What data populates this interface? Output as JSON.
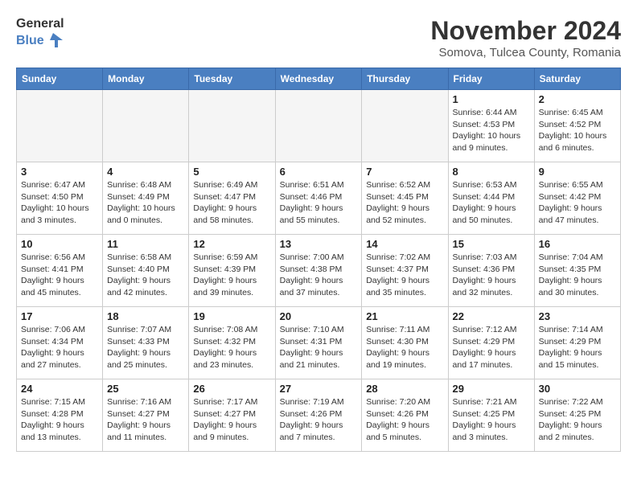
{
  "header": {
    "logo_line1": "General",
    "logo_line2": "Blue",
    "month_title": "November 2024",
    "subtitle": "Somova, Tulcea County, Romania"
  },
  "days_of_week": [
    "Sunday",
    "Monday",
    "Tuesday",
    "Wednesday",
    "Thursday",
    "Friday",
    "Saturday"
  ],
  "weeks": [
    [
      {
        "day": "",
        "info": ""
      },
      {
        "day": "",
        "info": ""
      },
      {
        "day": "",
        "info": ""
      },
      {
        "day": "",
        "info": ""
      },
      {
        "day": "",
        "info": ""
      },
      {
        "day": "1",
        "info": "Sunrise: 6:44 AM\nSunset: 4:53 PM\nDaylight: 10 hours and 9 minutes."
      },
      {
        "day": "2",
        "info": "Sunrise: 6:45 AM\nSunset: 4:52 PM\nDaylight: 10 hours and 6 minutes."
      }
    ],
    [
      {
        "day": "3",
        "info": "Sunrise: 6:47 AM\nSunset: 4:50 PM\nDaylight: 10 hours and 3 minutes."
      },
      {
        "day": "4",
        "info": "Sunrise: 6:48 AM\nSunset: 4:49 PM\nDaylight: 10 hours and 0 minutes."
      },
      {
        "day": "5",
        "info": "Sunrise: 6:49 AM\nSunset: 4:47 PM\nDaylight: 9 hours and 58 minutes."
      },
      {
        "day": "6",
        "info": "Sunrise: 6:51 AM\nSunset: 4:46 PM\nDaylight: 9 hours and 55 minutes."
      },
      {
        "day": "7",
        "info": "Sunrise: 6:52 AM\nSunset: 4:45 PM\nDaylight: 9 hours and 52 minutes."
      },
      {
        "day": "8",
        "info": "Sunrise: 6:53 AM\nSunset: 4:44 PM\nDaylight: 9 hours and 50 minutes."
      },
      {
        "day": "9",
        "info": "Sunrise: 6:55 AM\nSunset: 4:42 PM\nDaylight: 9 hours and 47 minutes."
      }
    ],
    [
      {
        "day": "10",
        "info": "Sunrise: 6:56 AM\nSunset: 4:41 PM\nDaylight: 9 hours and 45 minutes."
      },
      {
        "day": "11",
        "info": "Sunrise: 6:58 AM\nSunset: 4:40 PM\nDaylight: 9 hours and 42 minutes."
      },
      {
        "day": "12",
        "info": "Sunrise: 6:59 AM\nSunset: 4:39 PM\nDaylight: 9 hours and 39 minutes."
      },
      {
        "day": "13",
        "info": "Sunrise: 7:00 AM\nSunset: 4:38 PM\nDaylight: 9 hours and 37 minutes."
      },
      {
        "day": "14",
        "info": "Sunrise: 7:02 AM\nSunset: 4:37 PM\nDaylight: 9 hours and 35 minutes."
      },
      {
        "day": "15",
        "info": "Sunrise: 7:03 AM\nSunset: 4:36 PM\nDaylight: 9 hours and 32 minutes."
      },
      {
        "day": "16",
        "info": "Sunrise: 7:04 AM\nSunset: 4:35 PM\nDaylight: 9 hours and 30 minutes."
      }
    ],
    [
      {
        "day": "17",
        "info": "Sunrise: 7:06 AM\nSunset: 4:34 PM\nDaylight: 9 hours and 27 minutes."
      },
      {
        "day": "18",
        "info": "Sunrise: 7:07 AM\nSunset: 4:33 PM\nDaylight: 9 hours and 25 minutes."
      },
      {
        "day": "19",
        "info": "Sunrise: 7:08 AM\nSunset: 4:32 PM\nDaylight: 9 hours and 23 minutes."
      },
      {
        "day": "20",
        "info": "Sunrise: 7:10 AM\nSunset: 4:31 PM\nDaylight: 9 hours and 21 minutes."
      },
      {
        "day": "21",
        "info": "Sunrise: 7:11 AM\nSunset: 4:30 PM\nDaylight: 9 hours and 19 minutes."
      },
      {
        "day": "22",
        "info": "Sunrise: 7:12 AM\nSunset: 4:29 PM\nDaylight: 9 hours and 17 minutes."
      },
      {
        "day": "23",
        "info": "Sunrise: 7:14 AM\nSunset: 4:29 PM\nDaylight: 9 hours and 15 minutes."
      }
    ],
    [
      {
        "day": "24",
        "info": "Sunrise: 7:15 AM\nSunset: 4:28 PM\nDaylight: 9 hours and 13 minutes."
      },
      {
        "day": "25",
        "info": "Sunrise: 7:16 AM\nSunset: 4:27 PM\nDaylight: 9 hours and 11 minutes."
      },
      {
        "day": "26",
        "info": "Sunrise: 7:17 AM\nSunset: 4:27 PM\nDaylight: 9 hours and 9 minutes."
      },
      {
        "day": "27",
        "info": "Sunrise: 7:19 AM\nSunset: 4:26 PM\nDaylight: 9 hours and 7 minutes."
      },
      {
        "day": "28",
        "info": "Sunrise: 7:20 AM\nSunset: 4:26 PM\nDaylight: 9 hours and 5 minutes."
      },
      {
        "day": "29",
        "info": "Sunrise: 7:21 AM\nSunset: 4:25 PM\nDaylight: 9 hours and 3 minutes."
      },
      {
        "day": "30",
        "info": "Sunrise: 7:22 AM\nSunset: 4:25 PM\nDaylight: 9 hours and 2 minutes."
      }
    ]
  ]
}
